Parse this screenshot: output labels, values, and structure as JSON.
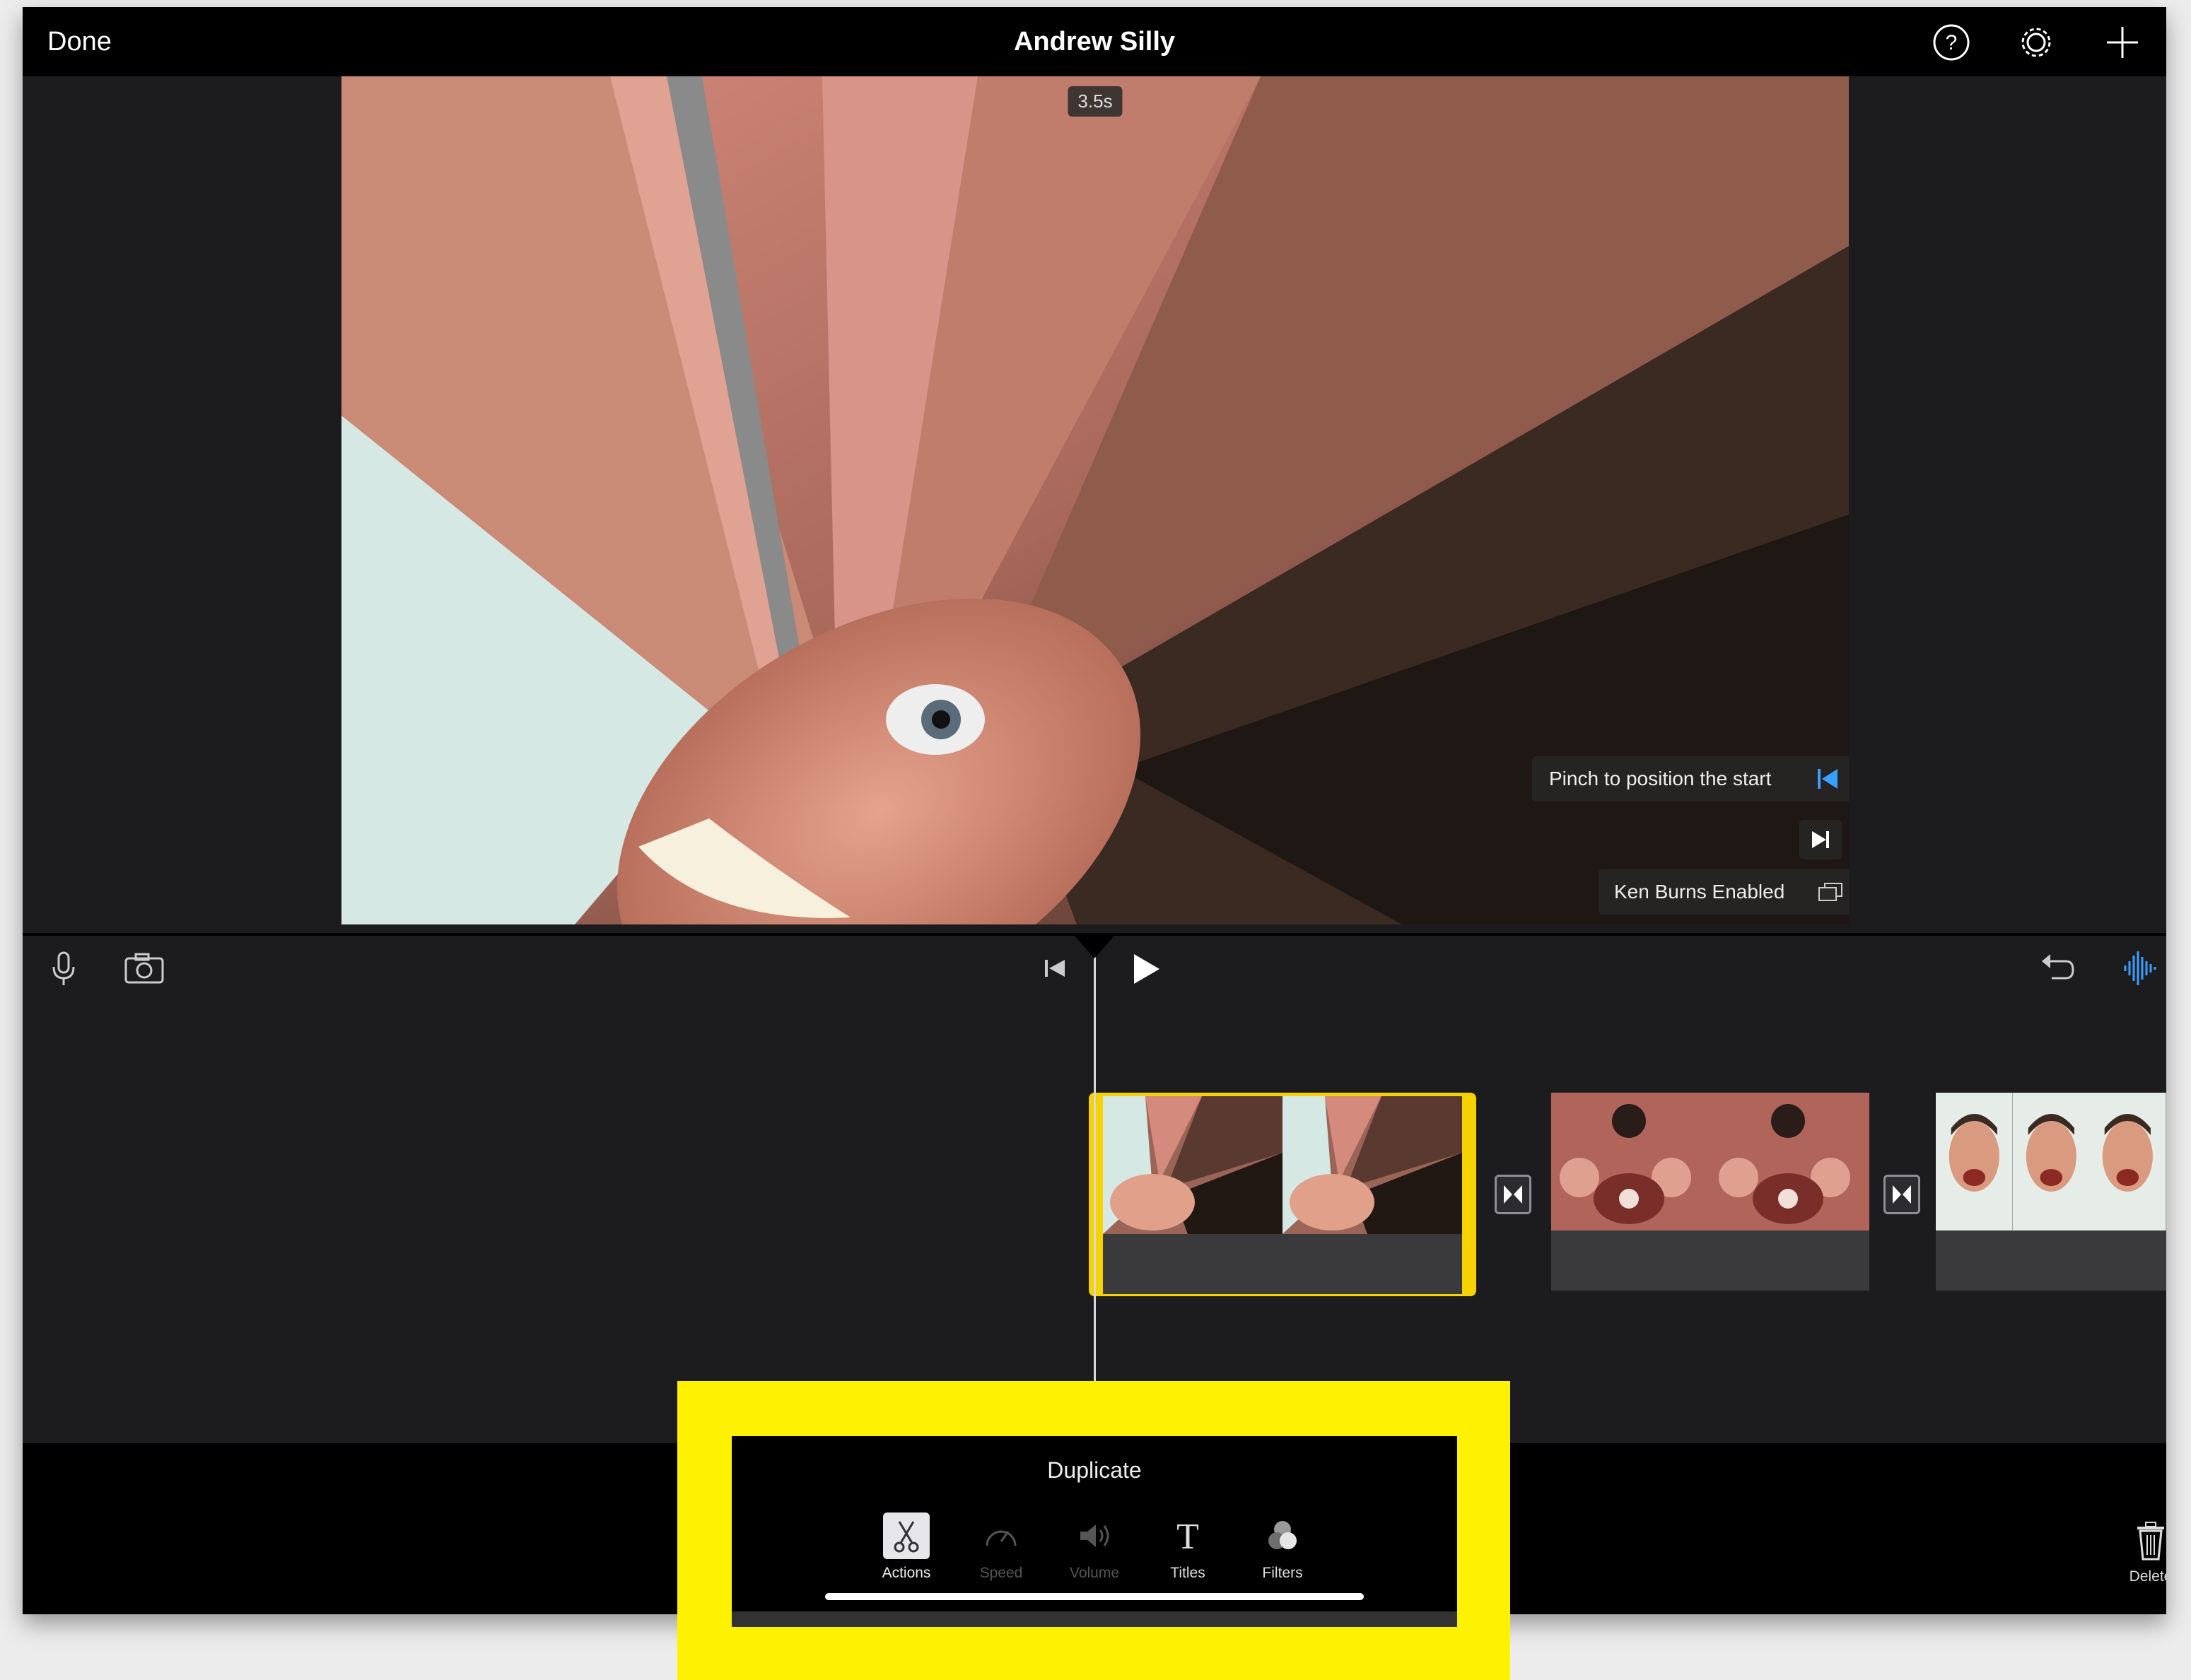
{
  "topbar": {
    "done_label": "Done",
    "project_title": "Andrew Silly",
    "icons": [
      "help-icon",
      "settings-gear-icon",
      "add-plus-icon"
    ]
  },
  "preview": {
    "time_badge": "3.5s",
    "pinch_hint": "Pinch to position the start",
    "ken_burns": "Ken Burns Enabled"
  },
  "controls": {
    "icons": [
      "microphone-icon",
      "camera-icon",
      "skip-to-start-icon",
      "play-icon",
      "undo-icon",
      "audio-waveform-icon"
    ]
  },
  "timeline": {
    "clips": [
      {
        "name": "selected-clip",
        "thumbs": 2
      },
      {
        "name": "kaleidoscope-clip",
        "thumbs": 2
      },
      {
        "name": "faces-clip",
        "thumbs": 3
      }
    ]
  },
  "inspector": {
    "panel_label": "Duplicate",
    "tools": [
      {
        "label": "Actions",
        "icon": "scissors-icon",
        "enabled": true,
        "active": true
      },
      {
        "label": "Speed",
        "icon": "speedometer-icon",
        "enabled": false,
        "active": false
      },
      {
        "label": "Volume",
        "icon": "speaker-icon",
        "enabled": false,
        "active": false
      },
      {
        "label": "Titles",
        "icon": "titles-t-icon",
        "enabled": true,
        "active": false
      },
      {
        "label": "Filters",
        "icon": "filters-circles-icon",
        "enabled": true,
        "active": false
      }
    ],
    "delete_label": "Delete"
  },
  "colors": {
    "accent_yellow": "#f6d200",
    "highlight_yellow": "#fff200",
    "accent_blue": "#3aa0ff",
    "background": "#1c1c1e"
  }
}
